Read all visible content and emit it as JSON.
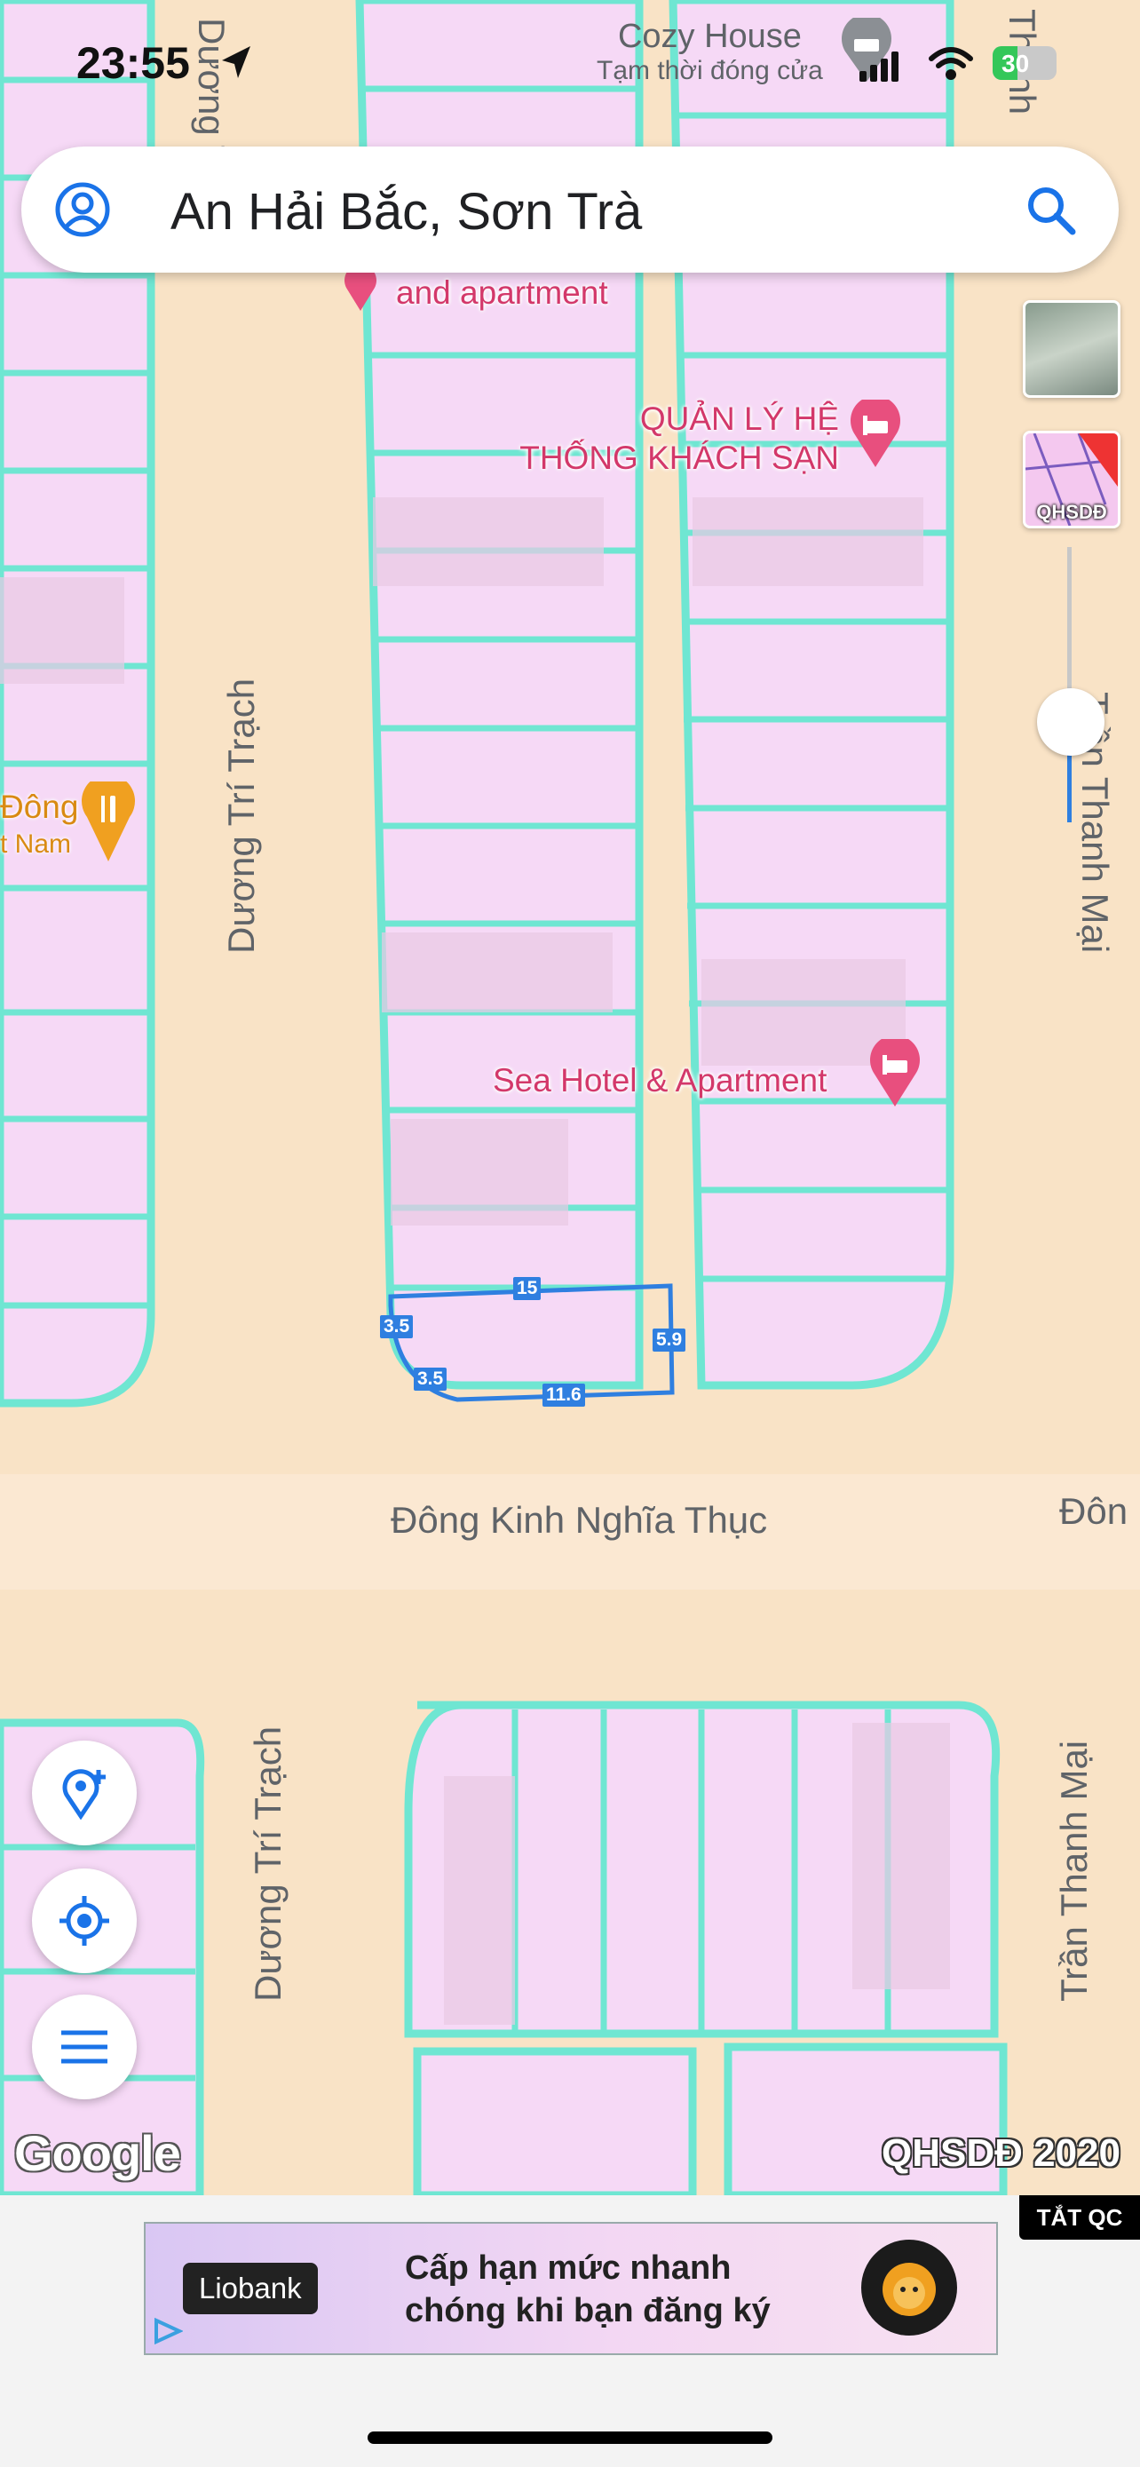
{
  "status_bar": {
    "time": "23:55",
    "battery": "30",
    "overlay_place_name": "Cozy House",
    "overlay_place_status": "Tạm thời đóng cửa"
  },
  "search": {
    "query": "An Hải Bắc, Sơn Trà"
  },
  "map": {
    "streets": {
      "duong_tri_trach_top": "Dương Trí Trạch",
      "duong_tri_trach_bottom": "Dương Trí Trạch",
      "dong_kinh_nghia_thuc": "Đông Kinh Nghĩa Thục",
      "dong_right_edge": "Đôn",
      "tran_thanh_mai_top": "Trần Thanh Mại",
      "tran_thanh_mai_bottom": "Trần Thanh Mại",
      "top_left_partial": "Dương Trí",
      "top_right_partial": "Thanh"
    },
    "pois": {
      "apartment_partial": "and apartment",
      "hotel_mgmt_line1": "QUẢN LÝ HỆ",
      "hotel_mgmt_line2": "THỐNG KHÁCH SẠN",
      "sea_hotel": "Sea Hotel & Apartment",
      "restaurant_line1": "Đông",
      "restaurant_line2": "t Nam"
    },
    "measurements": {
      "top": "15",
      "right": "5.9",
      "left_upper": "3.5",
      "left_lower": "3.5",
      "bottom": "11.6"
    },
    "layer_label": "QHSDĐ",
    "watermark": "QHSDĐ 2020",
    "google_logo": "Google",
    "colors": {
      "land": "#f9e3c6",
      "parcel": "#f6d9f6",
      "parcel_border": "#6fe6d2",
      "poi": "#d3386a",
      "measure": "#2f7fe0"
    }
  },
  "ad": {
    "dismiss_label": "TẮT QC",
    "brand": "Liobank",
    "line1": "Cấp hạn mức nhanh",
    "line2": "chóng khi bạn đăng ký"
  },
  "icons": [
    "profile-icon",
    "search-icon",
    "add-location-icon",
    "my-location-icon",
    "menu-icon",
    "navigation-arrow-icon",
    "signal-icon",
    "wifi-icon",
    "battery-icon",
    "hotel-pin-icon",
    "restaurant-pin-icon",
    "ad-play-icon"
  ]
}
